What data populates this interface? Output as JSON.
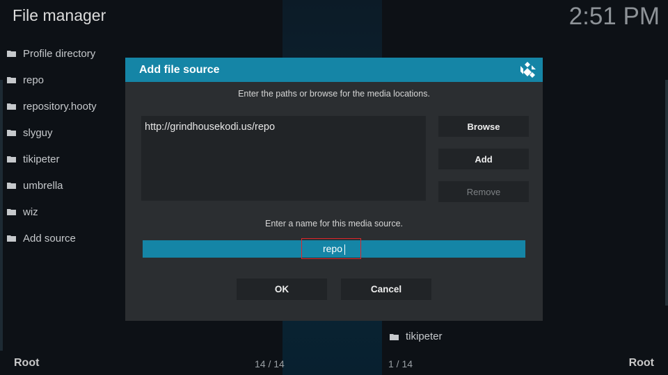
{
  "header": {
    "title": "File manager",
    "clock": "2:51 PM"
  },
  "sidebar": {
    "items": [
      {
        "label": "Profile directory",
        "icon": "folder-icon"
      },
      {
        "label": "repo",
        "icon": "folder-icon"
      },
      {
        "label": "repository.hooty",
        "icon": "folder-icon"
      },
      {
        "label": "slyguy",
        "icon": "folder-icon"
      },
      {
        "label": "tikipeter",
        "icon": "folder-icon"
      },
      {
        "label": "umbrella",
        "icon": "folder-icon"
      },
      {
        "label": "wiz",
        "icon": "folder-icon"
      },
      {
        "label": "Add source",
        "icon": "folder-icon"
      }
    ]
  },
  "right_pane": {
    "item": {
      "label": "tikipeter",
      "icon": "folder-icon"
    }
  },
  "footer": {
    "left": "Root",
    "right": "Root",
    "left_counter": "14 / 14",
    "right_counter": "1 / 14"
  },
  "dialog": {
    "title": "Add file source",
    "logo_icon": "kodi-logo-icon",
    "instructions": "Enter the paths or browse for the media locations.",
    "paths": [
      "http://grindhousekodi.us/repo"
    ],
    "buttons": {
      "browse": "Browse",
      "add": "Add",
      "remove": "Remove"
    },
    "name_label": "Enter a name for this media source.",
    "name_value": "repo",
    "ok": "OK",
    "cancel": "Cancel"
  },
  "colors": {
    "accent": "#1585a6",
    "dialog_bg": "#2b2e31",
    "field_bg": "#212427",
    "highlight": "#e0262a",
    "background": "#0d1116"
  }
}
